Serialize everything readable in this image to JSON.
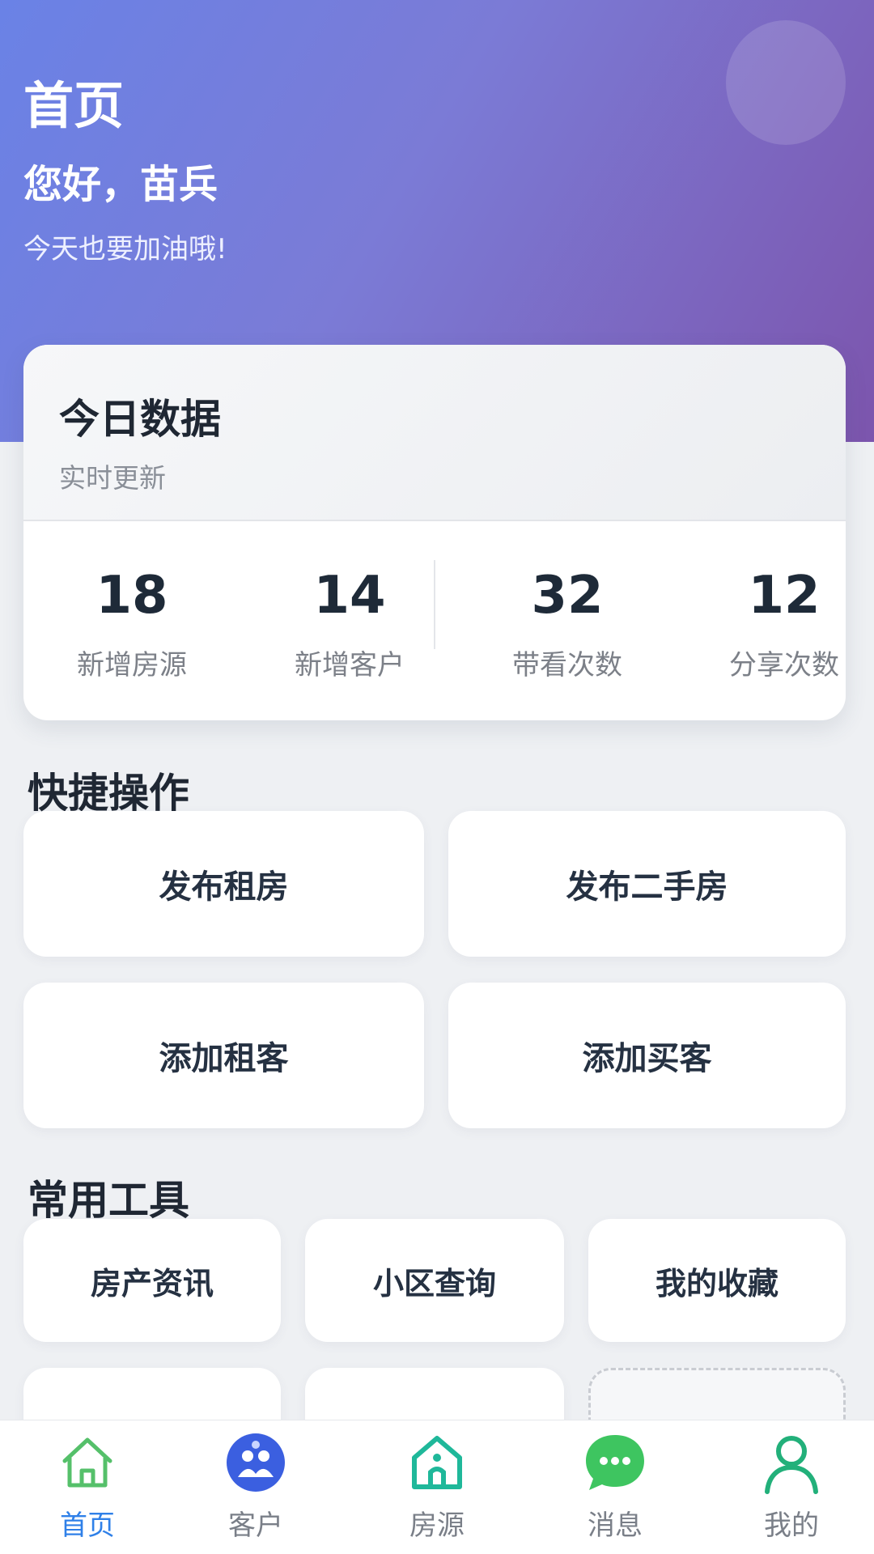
{
  "header": {
    "title": "首页",
    "greeting": "您好，苗兵",
    "subtitle": "今天也要加油哦!"
  },
  "today_stats": {
    "title": "今日数据",
    "subtitle": "实时更新",
    "items": [
      {
        "value": "18",
        "label": "新增房源"
      },
      {
        "value": "14",
        "label": "新增客户"
      },
      {
        "value": "32",
        "label": "带看次数"
      },
      {
        "value": "12",
        "label": "分享次数"
      }
    ]
  },
  "quick_actions": {
    "title": "快捷操作",
    "items": [
      "发布租房",
      "发布二手房",
      "添加租客",
      "添加买客"
    ]
  },
  "tools": {
    "title": "常用工具",
    "items": [
      "房产资讯",
      "小区查询",
      "我的收藏"
    ]
  },
  "bottom_nav": {
    "items": [
      {
        "label": "首页",
        "icon": "home-icon",
        "active": true
      },
      {
        "label": "客户",
        "icon": "customer-icon"
      },
      {
        "label": "房源",
        "icon": "house-icon"
      },
      {
        "label": "消息",
        "icon": "message-icon"
      },
      {
        "label": "我的",
        "icon": "profile-icon"
      }
    ]
  },
  "colors": {
    "header_gradient_start": "#6a82e6",
    "header_gradient_end": "#7c55ad",
    "active_tab": "#2f80e8",
    "home_icon": "#55c06a",
    "customer_icon": "#3b5fe0",
    "house_icon": "#1fb89a",
    "message_icon": "#3ec560",
    "profile_icon": "#22b07a"
  }
}
